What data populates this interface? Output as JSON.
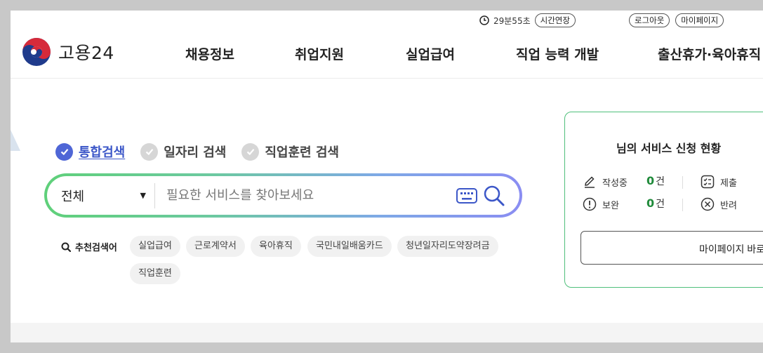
{
  "util": {
    "timer": "29분55초",
    "extend_label": "시간연장",
    "logout_label": "로그아웃",
    "mypage_label": "마이페이지"
  },
  "logo": {
    "text": "고용24"
  },
  "nav": [
    "채용정보",
    "취업지원",
    "실업급여",
    "직업 능력 개발",
    "출산휴가·육아휴직"
  ],
  "search": {
    "tabs": [
      "통합검색",
      "일자리 검색",
      "직업훈련 검색"
    ],
    "active_tab": 0,
    "scope": "전체",
    "placeholder": "필요한 서비스를 찾아보세요"
  },
  "recommend": {
    "label": "추천검색어",
    "keywords": [
      "실업급여",
      "근로계약서",
      "육아휴직",
      "국민내일배움카드",
      "청년일자리도약장려금",
      "직업훈련"
    ]
  },
  "status_card": {
    "title": "님의 서비스 신청 현황",
    "items": [
      {
        "label": "작성중",
        "count": "0",
        "unit": "건",
        "icon": "pencil-icon"
      },
      {
        "label": "제출",
        "icon": "checklist-icon"
      },
      {
        "label": "보완",
        "count": "0",
        "unit": "건",
        "icon": "exclamation-circle-icon"
      },
      {
        "label": "반려",
        "icon": "x-circle-icon"
      }
    ],
    "mypage_button": "마이페이지 바로"
  },
  "colors": {
    "accent_blue": "#4f66d6",
    "accent_green": "#4fbf7b",
    "count_green": "#1f8a3a"
  }
}
